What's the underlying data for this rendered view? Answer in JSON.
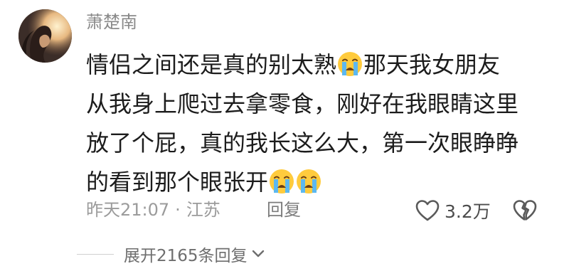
{
  "comment": {
    "username": "萧楚南",
    "lines": [
      [
        "情侣之间还是真的别太熟",
        "那天我女朋友"
      ],
      [
        "从我身上爬过去拿零食，刚好在我眼睛这里"
      ],
      [
        "放了个屁，真的我长这么大，第一次眼睁睁"
      ],
      [
        "的看到那个眼张开"
      ]
    ],
    "emoji_name": "loudly-crying-face",
    "time": "昨天21:07",
    "separator": "·",
    "location": "江苏",
    "reply_label": "回复",
    "like_count": "3.2万",
    "expand_label": "展开2165条回复"
  },
  "colors": {
    "username": "#8a8a8a",
    "text": "#1c1c1c",
    "meta": "#9b9b9b",
    "icon_stroke": "#5a5a5a"
  },
  "icons": {
    "like": "heart-outline-icon",
    "dislike": "broken-heart-icon",
    "expand": "chevron-down-icon"
  }
}
